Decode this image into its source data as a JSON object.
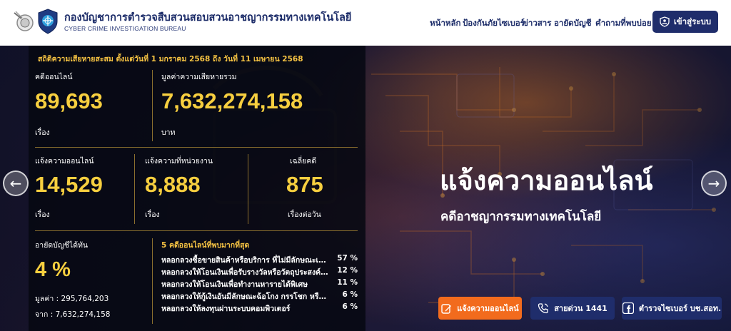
{
  "header": {
    "org_name_th": "กองบัญชาการตำรวจสืบสวนสอบสวนอาชญากรรมทางเทคโนโลยี",
    "org_name_en": "CYBER CRIME INVESTIGATION BUREAU",
    "nav": [
      "หน้าหลัก",
      "ป้องกันภัยไซเบอร์",
      "ข่าวสาร",
      "อายัดบัญชี",
      "คำถามที่พบบ่อย"
    ],
    "login_label": "เข้าสู่ระบบ"
  },
  "stats": {
    "heading": "สถิติความเสียหายสะสม ตั้งแต่วันที่ 1 มกราคม 2568 ถึง วันที่ 11 เมษายน 2568",
    "online_cases": {
      "label": "คดีออนไลน์",
      "value": "89,693",
      "unit": "เรื่อง"
    },
    "total_damage": {
      "label": "มูลค่าความเสียหายรวม",
      "value": "7,632,274,158",
      "unit": "บาท"
    },
    "online_reports": {
      "label": "แจ้งความออนไลน์",
      "value": "14,529",
      "unit": "เรื่อง"
    },
    "agency_reports": {
      "label": "แจ้งความที่หน่วยงาน",
      "value": "8,888",
      "unit": "เรื่อง"
    },
    "daily_avg": {
      "label": "เฉลี่ยคดี",
      "value": "875",
      "unit": "เรื่องต่อวัน"
    },
    "frozen": {
      "label": "อายัดบัญชีได้ทัน",
      "value": "4 %",
      "amount_line": "มูลค่า : 295,764,203",
      "from_line": "จาก : 7,632,274,158"
    },
    "top5": {
      "title": "5 คดีออนไลน์ที่พบมากที่สุด",
      "items": [
        {
          "label": "หลอกลวงซื้อขายสินค้าหรือบริการ ที่ไม่มีลักษณะเป็นขบวนการ",
          "pct": "57 %"
        },
        {
          "label": "หลอกลวงให้โอนเงินเพื่อรับรางวัลหรือวัตถุประสงค์อื่นๆ",
          "pct": "12 %"
        },
        {
          "label": "หลอกลวงให้โอนเงินเพื่อทำงานหารายได้พิเศษ",
          "pct": "11 %"
        },
        {
          "label": "หลอกลวงให้กู้เงินอันมีลักษณะฉ้อโกง กรรโชก หรือรีดเอาทรัพย์",
          "pct": "6 %"
        },
        {
          "label": "หลอกลวงให้ลงทุนผ่านระบบคอมพิวเตอร์",
          "pct": "6 %"
        }
      ]
    }
  },
  "hero": {
    "title": "แจ้งความออนไลน์",
    "subtitle": "คดีอาชญากรรมทางเทคโนโลยี"
  },
  "cta": {
    "report_label": "แจ้งความออนไลน์",
    "hotline_label": "สายด่วน 1441",
    "facebook_label": "ตำรวจไซเบอร์ บช.สอท."
  },
  "colors": {
    "brand_navy": "#1f2d6b",
    "accent_yellow": "#f7cf3f",
    "cta_orange": "#f26b1d"
  }
}
